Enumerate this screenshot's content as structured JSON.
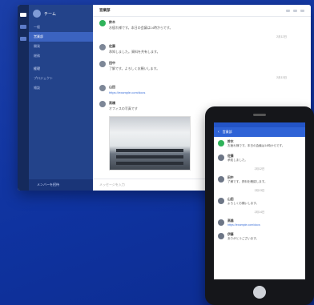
{
  "desktop": {
    "workspace_name": "チーム",
    "channels": [
      "一般",
      "営業部",
      "開発",
      "総務",
      "経理",
      "プロジェクト",
      "雑談"
    ],
    "selected_index": 1,
    "footer": "メンバーを招待",
    "channel_title": "営業部",
    "messages": [
      {
        "name": "鈴木",
        "text": "お疲れ様です。本日の会議は14時からです。",
        "avatar": "green"
      },
      {
        "name": "佐藤",
        "text": "承知しました。資料を共有します。",
        "avatar": "gray"
      },
      {
        "name": "田中",
        "text": "了解です。よろしくお願いします。",
        "avatar": "gray"
      },
      {
        "name": "山田",
        "text": "https://example.com/docs",
        "avatar": "gray",
        "link": true
      },
      {
        "name": "高橋",
        "text": "オフィスの写真です",
        "avatar": "gray"
      }
    ],
    "date_1": "2月12日",
    "date_2": "2月13日",
    "compose_placeholder": "メッセージを入力"
  },
  "phone": {
    "nav_title": "営業部",
    "messages": [
      {
        "name": "鈴木",
        "text": "お疲れ様です。本日の会議は14時からです。",
        "avatar": "green"
      },
      {
        "name": "佐藤",
        "text": "承知しました。",
        "avatar": "gray"
      },
      {
        "name": "田中",
        "text": "了解です。資料を確認します。",
        "avatar": "gray"
      },
      {
        "name": "山田",
        "text": "よろしくお願いします。",
        "avatar": "gray"
      },
      {
        "name": "高橋",
        "text": "https://example.com/docs",
        "avatar": "gray",
        "link": true
      },
      {
        "name": "伊藤",
        "text": "ありがとうございます。",
        "avatar": "gray"
      }
    ],
    "dates": [
      "2月12日",
      "2月13日",
      "2月14日"
    ]
  }
}
